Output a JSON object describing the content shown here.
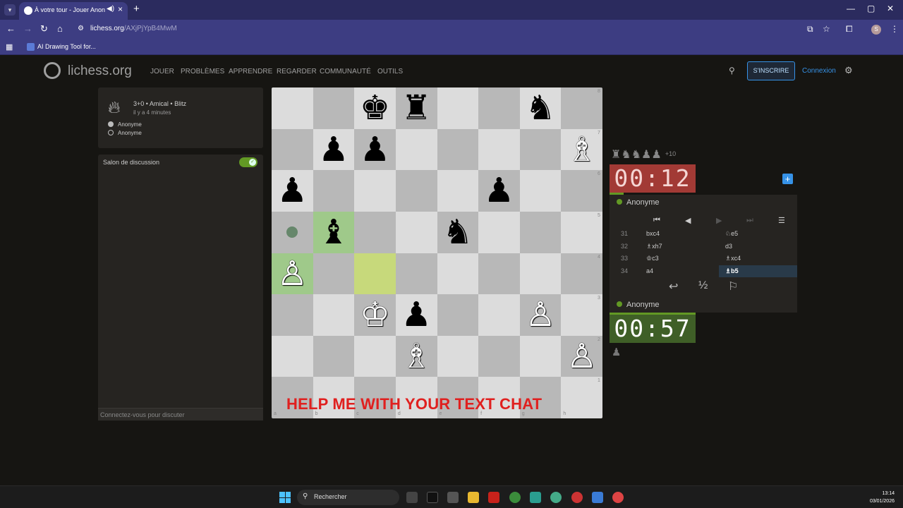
{
  "browser": {
    "tab_title": "À votre tour - Jouer Anon...",
    "url_host": "lichess.org",
    "url_path": "/AXjPjYpB4MwM",
    "bookmark": "AI Drawing Tool for..."
  },
  "site": {
    "logo": "lichess.org",
    "nav": [
      "JOUER",
      "PROBLÈMES",
      "APPRENDRE",
      "REGARDER",
      "COMMUNAUTÉ",
      "OUTILS"
    ],
    "signup": "S'INSCRIRE",
    "login": "Connexion"
  },
  "game_info": {
    "mode": "3+0 • Amical • Blitz",
    "time_ago": "il y a 4 minutes",
    "player_white": "Anonyme",
    "player_black": "Anonyme"
  },
  "chat": {
    "title": "Salon de discussion",
    "placeholder": "Connectez-vous pour discuter"
  },
  "board": {
    "files": [
      "a",
      "b",
      "c",
      "d",
      "e",
      "f",
      "g",
      "h"
    ],
    "ranks": [
      "8",
      "7",
      "6",
      "5",
      "4",
      "3",
      "2",
      "1"
    ],
    "pieces": [
      {
        "sq": "c8",
        "glyph": "♚",
        "color": "b"
      },
      {
        "sq": "d8",
        "glyph": "♜",
        "color": "b"
      },
      {
        "sq": "g8",
        "glyph": "♞",
        "color": "b"
      },
      {
        "sq": "b7",
        "glyph": "♟",
        "color": "b"
      },
      {
        "sq": "c7",
        "glyph": "♟",
        "color": "b"
      },
      {
        "sq": "h7",
        "glyph": "♗",
        "color": "w"
      },
      {
        "sq": "a6",
        "glyph": "♟",
        "color": "b"
      },
      {
        "sq": "f6",
        "glyph": "♟",
        "color": "b"
      },
      {
        "sq": "b5",
        "glyph": "♝",
        "color": "b"
      },
      {
        "sq": "e5",
        "glyph": "♞",
        "color": "b"
      },
      {
        "sq": "a4",
        "glyph": "♙",
        "color": "w"
      },
      {
        "sq": "c3",
        "glyph": "♔",
        "color": "w"
      },
      {
        "sq": "d3",
        "glyph": "♟",
        "color": "b"
      },
      {
        "sq": "g3",
        "glyph": "♙",
        "color": "w"
      },
      {
        "sq": "d2",
        "glyph": "♗",
        "color": "w"
      },
      {
        "sq": "h2",
        "glyph": "♙",
        "color": "w"
      }
    ],
    "highlight_dark": [
      "a4",
      "b5"
    ],
    "highlight_light": [
      "c4"
    ],
    "move_dot": "a5",
    "overlay_text": "HELP ME WITH YOUR TEXT CHAT"
  },
  "clocks": {
    "top": "00:12",
    "bottom": "00:57",
    "captured": "♜♞♞♟♟",
    "captured_plus": "+10"
  },
  "players": {
    "top": "Anonyme",
    "bottom": "Anonyme"
  },
  "moves": [
    {
      "n": "31",
      "w": "bxc4",
      "b": "♘e5"
    },
    {
      "n": "32",
      "w": "♗xh7",
      "b": "d3"
    },
    {
      "n": "33",
      "w": "♔c3",
      "b": "♗xc4"
    },
    {
      "n": "34",
      "w": "a4",
      "b": "♗b5"
    }
  ],
  "active_move_index": 3,
  "taskbar": {
    "search": "Rechercher",
    "time": "13:14",
    "date": "03/01/2026"
  }
}
